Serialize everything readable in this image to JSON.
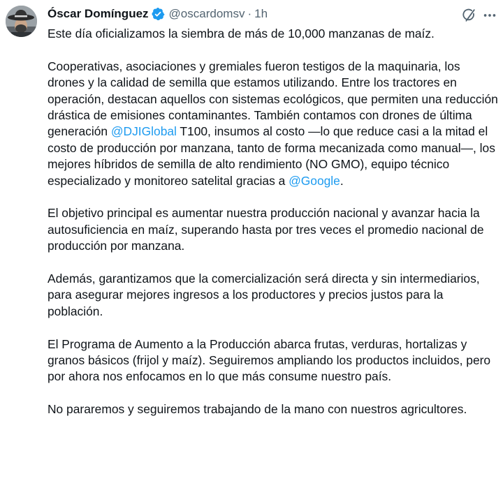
{
  "tweet": {
    "author_name": "Óscar Domínguez",
    "handle": "@oscardomsv",
    "separator": "·",
    "time": "1h",
    "verified_color": "#1d9bf0",
    "icons": {
      "avatar": "profile-photo-cowboy-hat",
      "verified": "verified-badge-icon",
      "grok": "grok-icon",
      "more": "more-horizontal-icon"
    },
    "paragraphs": {
      "p1": "Este día oficializamos la siembra de más de 10,000 manzanas de maíz.",
      "p2_a": "Cooperativas, asociaciones y gremiales fueron testigos de la maquinaria, los drones y la calidad de semilla que estamos utilizando. Entre los tractores en operación, destacan aquellos con sistemas ecológicos, que permiten una reducción drástica de emisiones contaminantes. También contamos con drones de última generación ",
      "p2_mention1": "@DJIGlobal",
      "p2_b": " T100, insumos al costo —lo que reduce casi a la mitad el costo de producción por manzana, tanto de forma mecanizada como manual—, los mejores híbridos de semilla de alto rendimiento (NO GMO), equipo técnico especializado y monitoreo satelital gracias a ",
      "p2_mention2": "@Google",
      "p2_c": ".",
      "p3": "El objetivo principal es aumentar nuestra producción nacional y avanzar hacia la autosuficiencia en maíz, superando hasta por tres veces el promedio nacional de producción por manzana.",
      "p4": "Además, garantizamos que la comercialización será directa y sin intermediarios, para asegurar mejores ingresos a los productores y precios justos para la población.",
      "p5": "El Programa de Aumento a la Producción abarca frutas, verduras, hortalizas y granos básicos (frijol y maíz). Seguiremos ampliando los productos incluidos, pero por ahora nos enfocamos en lo que más consume nuestro país.",
      "p6": "No pararemos y seguiremos trabajando de la mano con nuestros agricultores."
    }
  }
}
